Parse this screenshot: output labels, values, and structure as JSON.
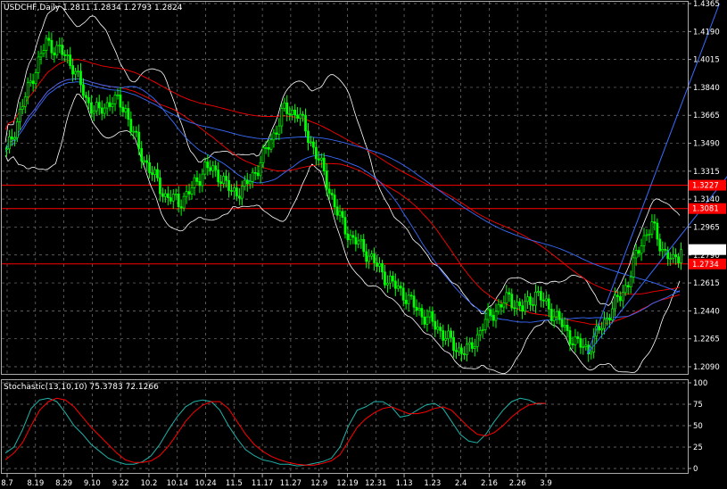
{
  "window": {
    "header": "USDCHF,Daily  1.2811 1.2834 1.2793 1.2824"
  },
  "colors": {
    "background": "#000000",
    "grid": "#7a7a7a",
    "bull_candle": "#00ff00",
    "bear_candle": "#00ff00",
    "bollinger": "#ffffff",
    "ma_red": "#ff0000",
    "ma_blue": "#3a6cff",
    "hline": "#ff0000",
    "trend": "#3a6cff",
    "stoch_main": "#20b2aa",
    "stoch_signal": "#ff0000",
    "current_price_box": "#ffffff",
    "current_price_text": "#000000",
    "level_box": "#ff0000",
    "level_text": "#ffffff"
  },
  "chart_data": [
    {
      "type": "candlestick",
      "title": "USDCHF,Daily",
      "ohlc_last": {
        "open": 1.2811,
        "high": 1.2834,
        "low": 1.2793,
        "close": 1.2824
      },
      "price_axis_labels": [
        "1.4365",
        "1.4190",
        "1.4015",
        "1.3840",
        "1.3665",
        "1.3490",
        "1.3315",
        "1.3140",
        "1.2965",
        "1.2790",
        "1.2615",
        "1.2440",
        "1.2265",
        "1.2090"
      ],
      "ylim": [
        1.209,
        1.4365
      ],
      "date_axis_labels": [
        "8.7",
        "8.19",
        "8.29",
        "9.10",
        "9.22",
        "10.2",
        "10.14",
        "10.24",
        "11.5",
        "11.17",
        "11.27",
        "12.9",
        "12.19",
        "12.31",
        "1.13",
        "1.23",
        "2.4",
        "2.16",
        "2.26",
        "3.9"
      ],
      "current_price": "1.2824",
      "horizontal_levels": [
        {
          "value": 1.3227,
          "label": "1.3227"
        },
        {
          "value": 1.3081,
          "label": "1.3081"
        },
        {
          "value": 1.2734,
          "label": "1.2734"
        }
      ],
      "close_keyframes": [
        [
          0,
          1.343
        ],
        [
          5,
          1.368
        ],
        [
          10,
          1.392
        ],
        [
          15,
          1.412
        ],
        [
          20,
          1.407
        ],
        [
          25,
          1.398
        ],
        [
          30,
          1.376
        ],
        [
          35,
          1.368
        ],
        [
          40,
          1.377
        ],
        [
          45,
          1.37
        ],
        [
          50,
          1.345
        ],
        [
          55,
          1.33
        ],
        [
          60,
          1.316
        ],
        [
          65,
          1.312
        ],
        [
          70,
          1.32
        ],
        [
          75,
          1.334
        ],
        [
          80,
          1.33
        ],
        [
          85,
          1.318
        ],
        [
          90,
          1.321
        ],
        [
          95,
          1.334
        ],
        [
          100,
          1.351
        ],
        [
          105,
          1.37
        ],
        [
          110,
          1.368
        ],
        [
          115,
          1.35
        ],
        [
          120,
          1.33
        ],
        [
          125,
          1.305
        ],
        [
          130,
          1.29
        ],
        [
          135,
          1.283
        ],
        [
          140,
          1.272
        ],
        [
          145,
          1.262
        ],
        [
          150,
          1.255
        ],
        [
          155,
          1.245
        ],
        [
          160,
          1.238
        ],
        [
          165,
          1.23
        ],
        [
          170,
          1.22
        ],
        [
          175,
          1.219
        ],
        [
          180,
          1.235
        ],
        [
          185,
          1.245
        ],
        [
          190,
          1.252
        ],
        [
          195,
          1.245
        ],
        [
          200,
          1.255
        ],
        [
          205,
          1.246
        ],
        [
          210,
          1.235
        ],
        [
          215,
          1.224
        ],
        [
          220,
          1.22
        ],
        [
          225,
          1.235
        ],
        [
          230,
          1.248
        ],
        [
          235,
          1.262
        ],
        [
          240,
          1.288
        ],
        [
          244,
          1.297
        ],
        [
          248,
          1.283
        ],
        [
          252,
          1.274
        ],
        [
          255,
          1.282
        ]
      ],
      "trend_lines": [
        {
          "from": [
            220,
            1.217
          ],
          "to": [
            270,
            1.4365
          ]
        },
        {
          "from": [
            220,
            1.217
          ],
          "to": [
            300,
            1.385
          ]
        }
      ]
    },
    {
      "type": "line",
      "title": "Stochastic(13,10,10)",
      "header": "Stochastic(13,10,10)  75.3783  72.1266",
      "main_value": 75.3783,
      "signal_value": 72.1266,
      "ylim": [
        0,
        100
      ],
      "axis_labels": [
        "100",
        "75",
        "50",
        "25",
        "0"
      ],
      "series": [
        {
          "role": "main",
          "values": [
            18,
            25,
            45,
            70,
            80,
            82,
            78,
            65,
            50,
            40,
            28,
            20,
            12,
            8,
            5,
            5,
            8,
            15,
            28,
            45,
            60,
            72,
            78,
            80,
            78,
            68,
            50,
            35,
            22,
            15,
            10,
            8,
            5,
            5,
            3,
            4,
            6,
            8,
            12,
            25,
            50,
            68,
            72,
            78,
            78,
            72,
            60,
            62,
            68,
            74,
            76,
            70,
            55,
            40,
            32,
            30,
            40,
            55,
            68,
            78,
            82,
            80,
            75,
            76
          ]
        },
        {
          "role": "signal",
          "values": [
            10,
            18,
            30,
            50,
            68,
            78,
            82,
            80,
            72,
            60,
            48,
            38,
            28,
            18,
            10,
            7,
            7,
            9,
            15,
            26,
            40,
            55,
            66,
            74,
            78,
            78,
            70,
            55,
            40,
            28,
            20,
            14,
            10,
            7,
            5,
            4,
            4,
            6,
            9,
            16,
            32,
            48,
            58,
            65,
            70,
            72,
            68,
            64,
            64,
            66,
            70,
            72,
            68,
            58,
            48,
            40,
            38,
            42,
            50,
            60,
            68,
            74,
            76,
            76
          ]
        }
      ]
    }
  ]
}
